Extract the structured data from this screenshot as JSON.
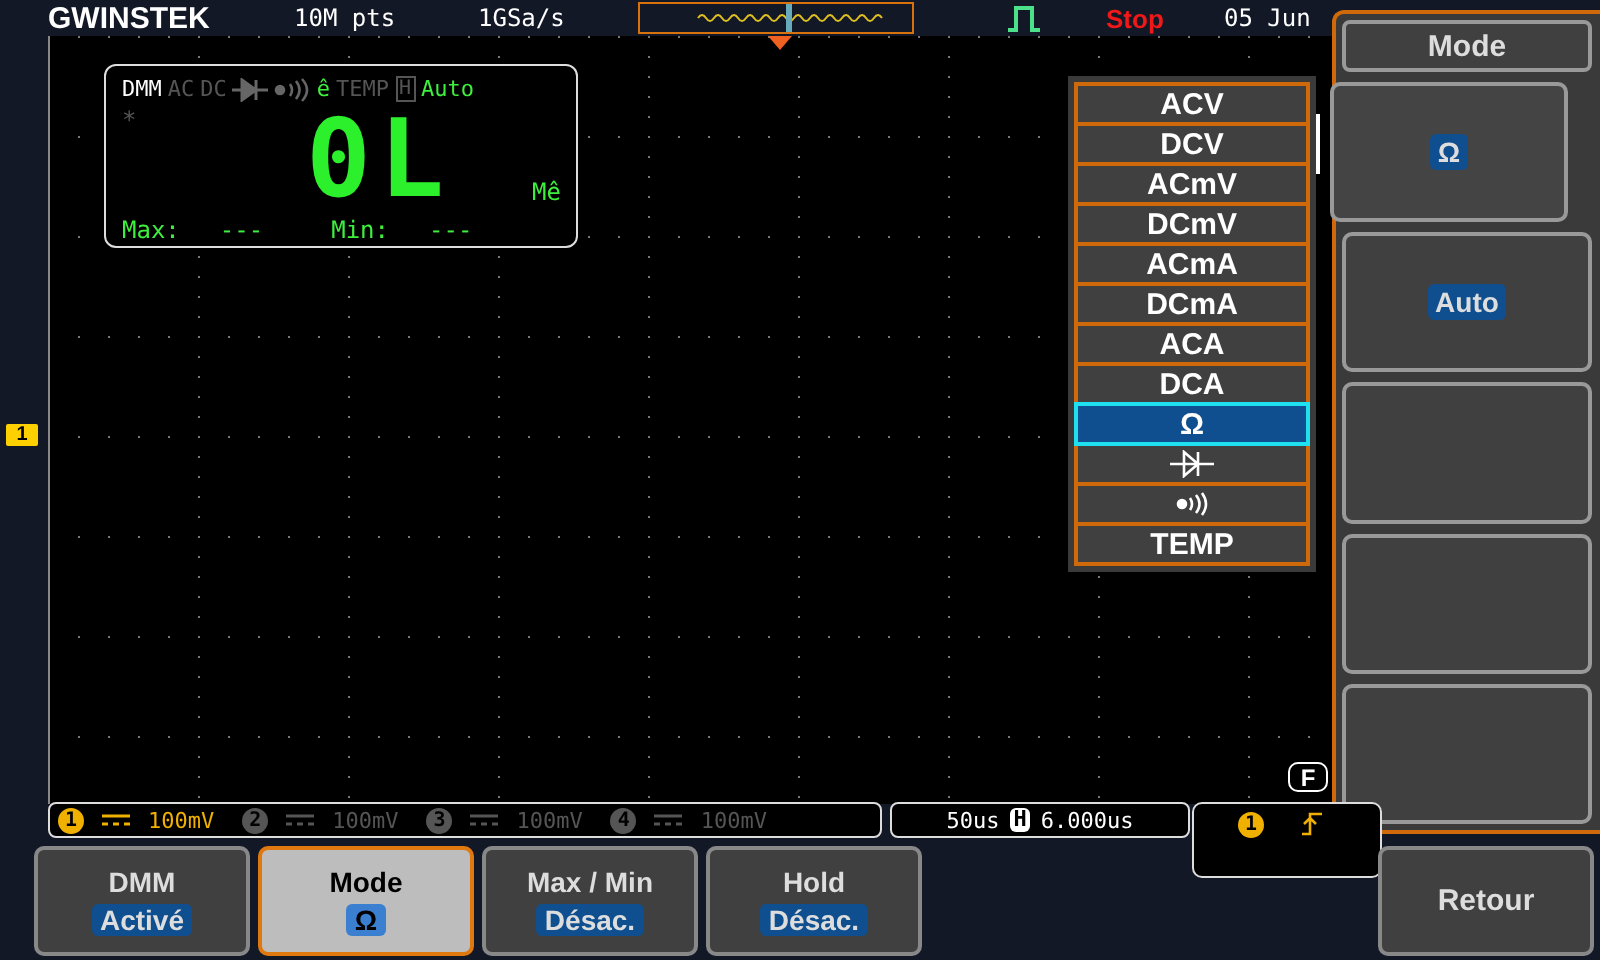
{
  "top_bar": {
    "logo": "GWINSTEK",
    "memory": "10M pts",
    "sample_rate": "1GSa/s",
    "run_state": "Stop",
    "date": "05 Jun"
  },
  "channel_marker": "1",
  "dmm": {
    "title": "DMM",
    "indicators": [
      {
        "kind": "text",
        "label": "AC",
        "active": false
      },
      {
        "kind": "text",
        "label": "DC",
        "active": false
      },
      {
        "kind": "diode",
        "active": false
      },
      {
        "kind": "continuity",
        "active": false
      },
      {
        "kind": "text",
        "label": "ê",
        "active": true
      },
      {
        "kind": "text",
        "label": "TEMP",
        "active": false
      },
      {
        "kind": "hold",
        "label": "H",
        "active": false
      },
      {
        "kind": "text",
        "label": "Auto",
        "active": true
      }
    ],
    "relative_mark": "*",
    "reading": "0L",
    "unit": "Mê",
    "max_label": "Max:",
    "max_value": "---",
    "min_label": "Min:",
    "min_value": "---"
  },
  "mode_menu": [
    {
      "kind": "text",
      "label": "ACV",
      "selected": false
    },
    {
      "kind": "text",
      "label": "DCV",
      "selected": false
    },
    {
      "kind": "text",
      "label": "ACmV",
      "selected": false
    },
    {
      "kind": "text",
      "label": "DCmV",
      "selected": false
    },
    {
      "kind": "text",
      "label": "ACmA",
      "selected": false
    },
    {
      "kind": "text",
      "label": "DCmA",
      "selected": false
    },
    {
      "kind": "text",
      "label": "ACA",
      "selected": false
    },
    {
      "kind": "text",
      "label": "DCA",
      "selected": false
    },
    {
      "kind": "text",
      "label": "Ω",
      "selected": true
    },
    {
      "kind": "diode",
      "selected": false
    },
    {
      "kind": "continuity",
      "selected": false
    },
    {
      "kind": "text",
      "label": "TEMP",
      "selected": false
    }
  ],
  "side_panel": {
    "title": "Mode",
    "keys": [
      {
        "kind": "value",
        "value": "Ω",
        "selected": true
      },
      {
        "kind": "value",
        "value": "Auto",
        "selected": false
      },
      {
        "kind": "empty"
      },
      {
        "kind": "empty"
      },
      {
        "kind": "empty"
      }
    ]
  },
  "channels": [
    {
      "number": "1",
      "scale": "100mV",
      "on": true
    },
    {
      "number": "2",
      "scale": "100mV",
      "on": false
    },
    {
      "number": "3",
      "scale": "100mV",
      "on": false
    },
    {
      "number": "4",
      "scale": "100mV",
      "on": false
    }
  ],
  "timebase": {
    "scale": "50us",
    "h_label": "H",
    "position": "6.000us"
  },
  "trigger": {
    "source": "1",
    "mode_badge": "F"
  },
  "softkeys": [
    {
      "label": "DMM",
      "value": "Activé",
      "selected": false
    },
    {
      "label": "Mode",
      "value": "Ω",
      "selected": true
    },
    {
      "label": "Max / Min",
      "value": "Désac.",
      "selected": false
    },
    {
      "label": "Hold",
      "value": "Désac.",
      "selected": false
    }
  ],
  "back_key": {
    "label": "Retour"
  }
}
